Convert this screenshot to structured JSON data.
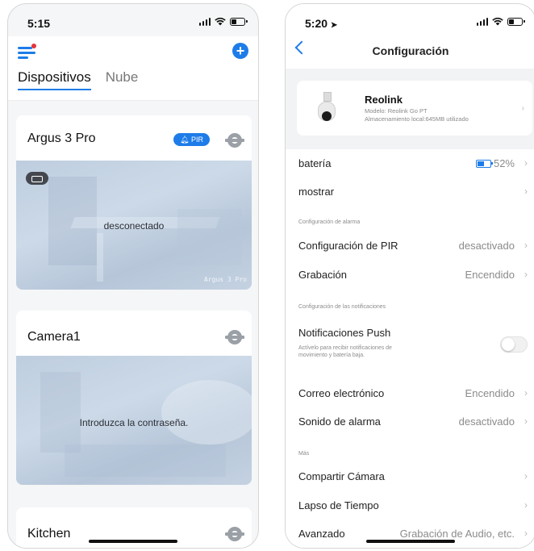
{
  "left": {
    "status": {
      "time": "5:15"
    },
    "tabs": [
      "Dispositivos",
      "Nube"
    ],
    "devices": [
      {
        "name": "Argus 3 Pro",
        "badge": "PIR",
        "preview_message": "desconectado",
        "preview_camera_label": "Argus 3 Pro"
      },
      {
        "name": "Camera1",
        "preview_message": "Introduzca la contraseña."
      },
      {
        "name": "Kitchen"
      }
    ]
  },
  "right": {
    "status": {
      "time": "5:20"
    },
    "title": "Configuración",
    "device": {
      "name": "Reolink",
      "model": "Modelo: Reolink Go PT",
      "storage": "Almacenamiento local:645MB utilizado"
    },
    "rows": {
      "battery": {
        "label": "batería",
        "value": "52%",
        "level": 0.52
      },
      "display": {
        "label": "mostrar"
      },
      "pir": {
        "label": "Configuración de PIR",
        "value": "desactivado"
      },
      "recording": {
        "label": "Grabación",
        "value": "Encendido"
      },
      "push": {
        "label": "Notificaciones Push",
        "description": "Actívelo para recibir notificaciones de movimiento y batería baja.",
        "enabled": false
      },
      "email": {
        "label": "Correo electrónico",
        "value": "Encendido"
      },
      "siren": {
        "label": "Sonido de alarma",
        "value": "desactivado"
      },
      "share": {
        "label": "Compartir Cámara"
      },
      "timelapse": {
        "label": "Lapso de Tiempo"
      },
      "advanced": {
        "label": "Avanzado",
        "value": "Grabación de Audio, etc."
      }
    },
    "sections": {
      "alarm": "Configuración de alarma",
      "notifications": "Configuración de las notificaciones",
      "more": "Más"
    }
  },
  "colors": {
    "accent": "#1e7ce8",
    "alert": "#e5343a"
  }
}
